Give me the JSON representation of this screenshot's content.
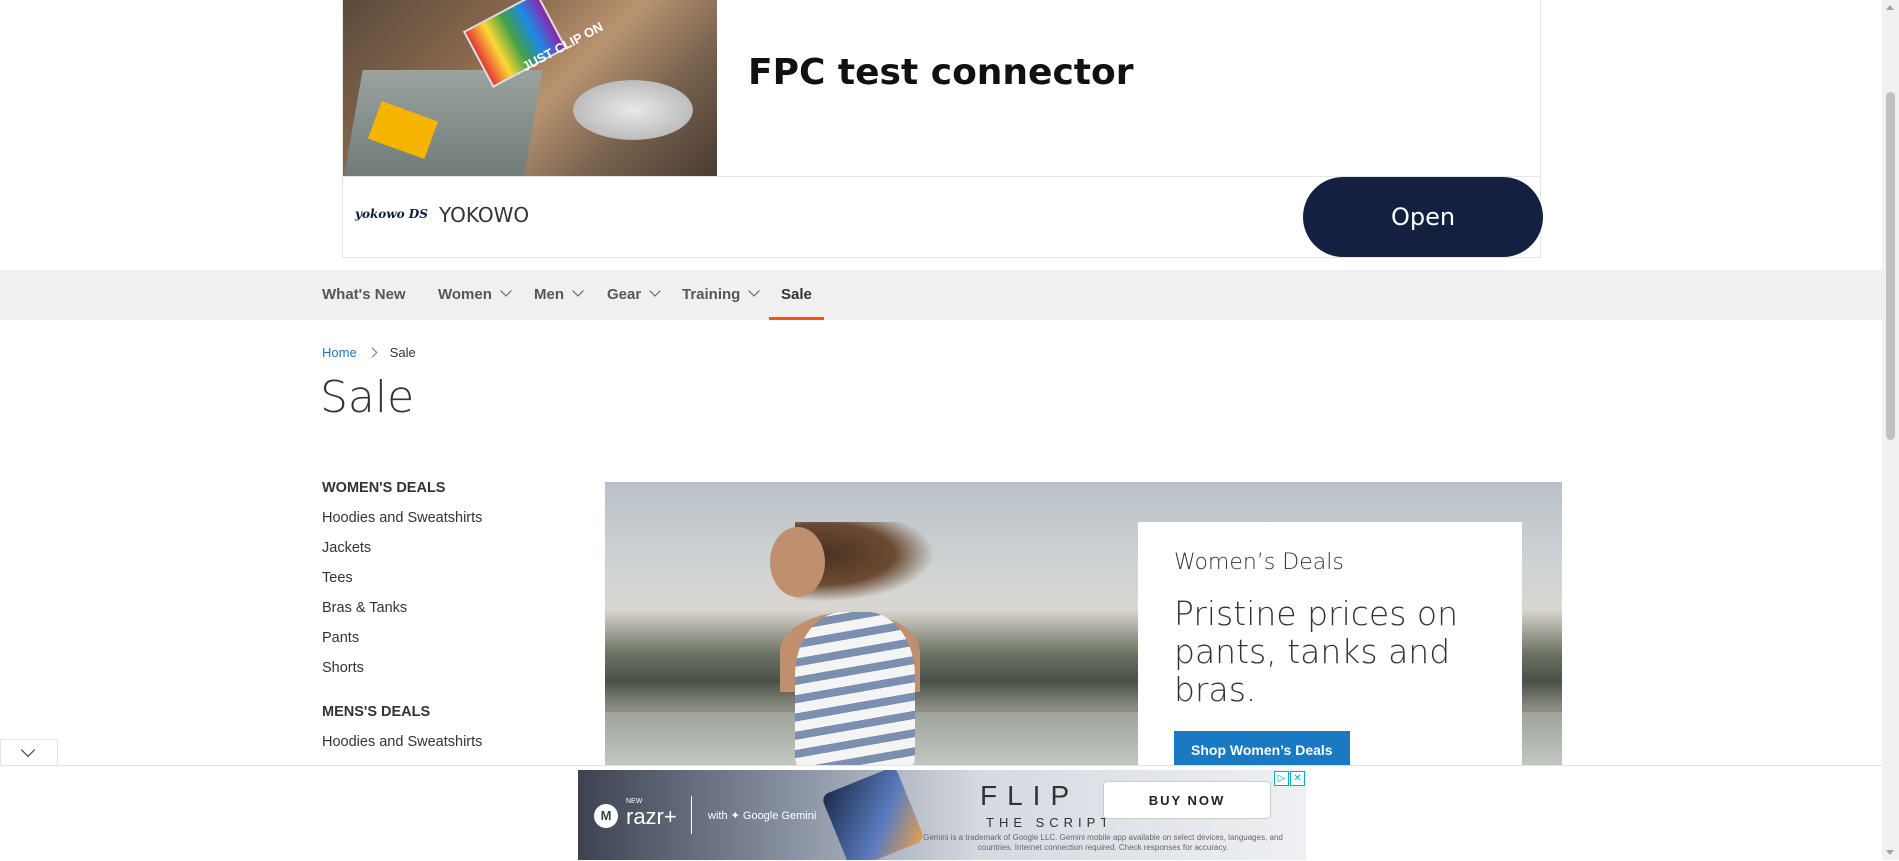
{
  "top_ad": {
    "image_caption": "JUST CLIP ON",
    "headline": "FPC test connector",
    "logo_text": "yokowo DS",
    "brand": "YOKOWO",
    "cta": "Open"
  },
  "nav": {
    "items": [
      {
        "label": "What's New",
        "has_dropdown": false
      },
      {
        "label": "Women",
        "has_dropdown": true
      },
      {
        "label": "Men",
        "has_dropdown": true
      },
      {
        "label": "Gear",
        "has_dropdown": true
      },
      {
        "label": "Training",
        "has_dropdown": true
      },
      {
        "label": "Sale",
        "has_dropdown": false,
        "active": true
      }
    ],
    "accent_color": "#ff5501"
  },
  "breadcrumb": {
    "home": "Home",
    "current": "Sale"
  },
  "page": {
    "title": "Sale"
  },
  "sidebar": {
    "womens": {
      "heading": "WOMEN'S DEALS",
      "links": [
        "Hoodies and Sweatshirts",
        "Jackets",
        "Tees",
        "Bras & Tanks",
        "Pants",
        "Shorts"
      ]
    },
    "mens": {
      "heading": "MENS'S DEALS",
      "links": [
        "Hoodies and Sweatshirts"
      ]
    }
  },
  "hero": {
    "eyebrow": "Women’s Deals",
    "headline": "Pristine prices on pants, tanks and bras.",
    "button": "Shop Women’s Deals",
    "button_color": "#1979c3"
  },
  "bottom_ad": {
    "new_label": "NEW",
    "brand": "razr+",
    "partner": "with ✦ Google Gemini",
    "flip": "FLIP",
    "script": "THE SCRIPT",
    "fine_print": "Gemini is a trademark of Google LLC. Gemini mobile app available on select devices, languages, and countries. Internet connection required. Check responses for accuracy.",
    "cta": "BUY NOW"
  }
}
